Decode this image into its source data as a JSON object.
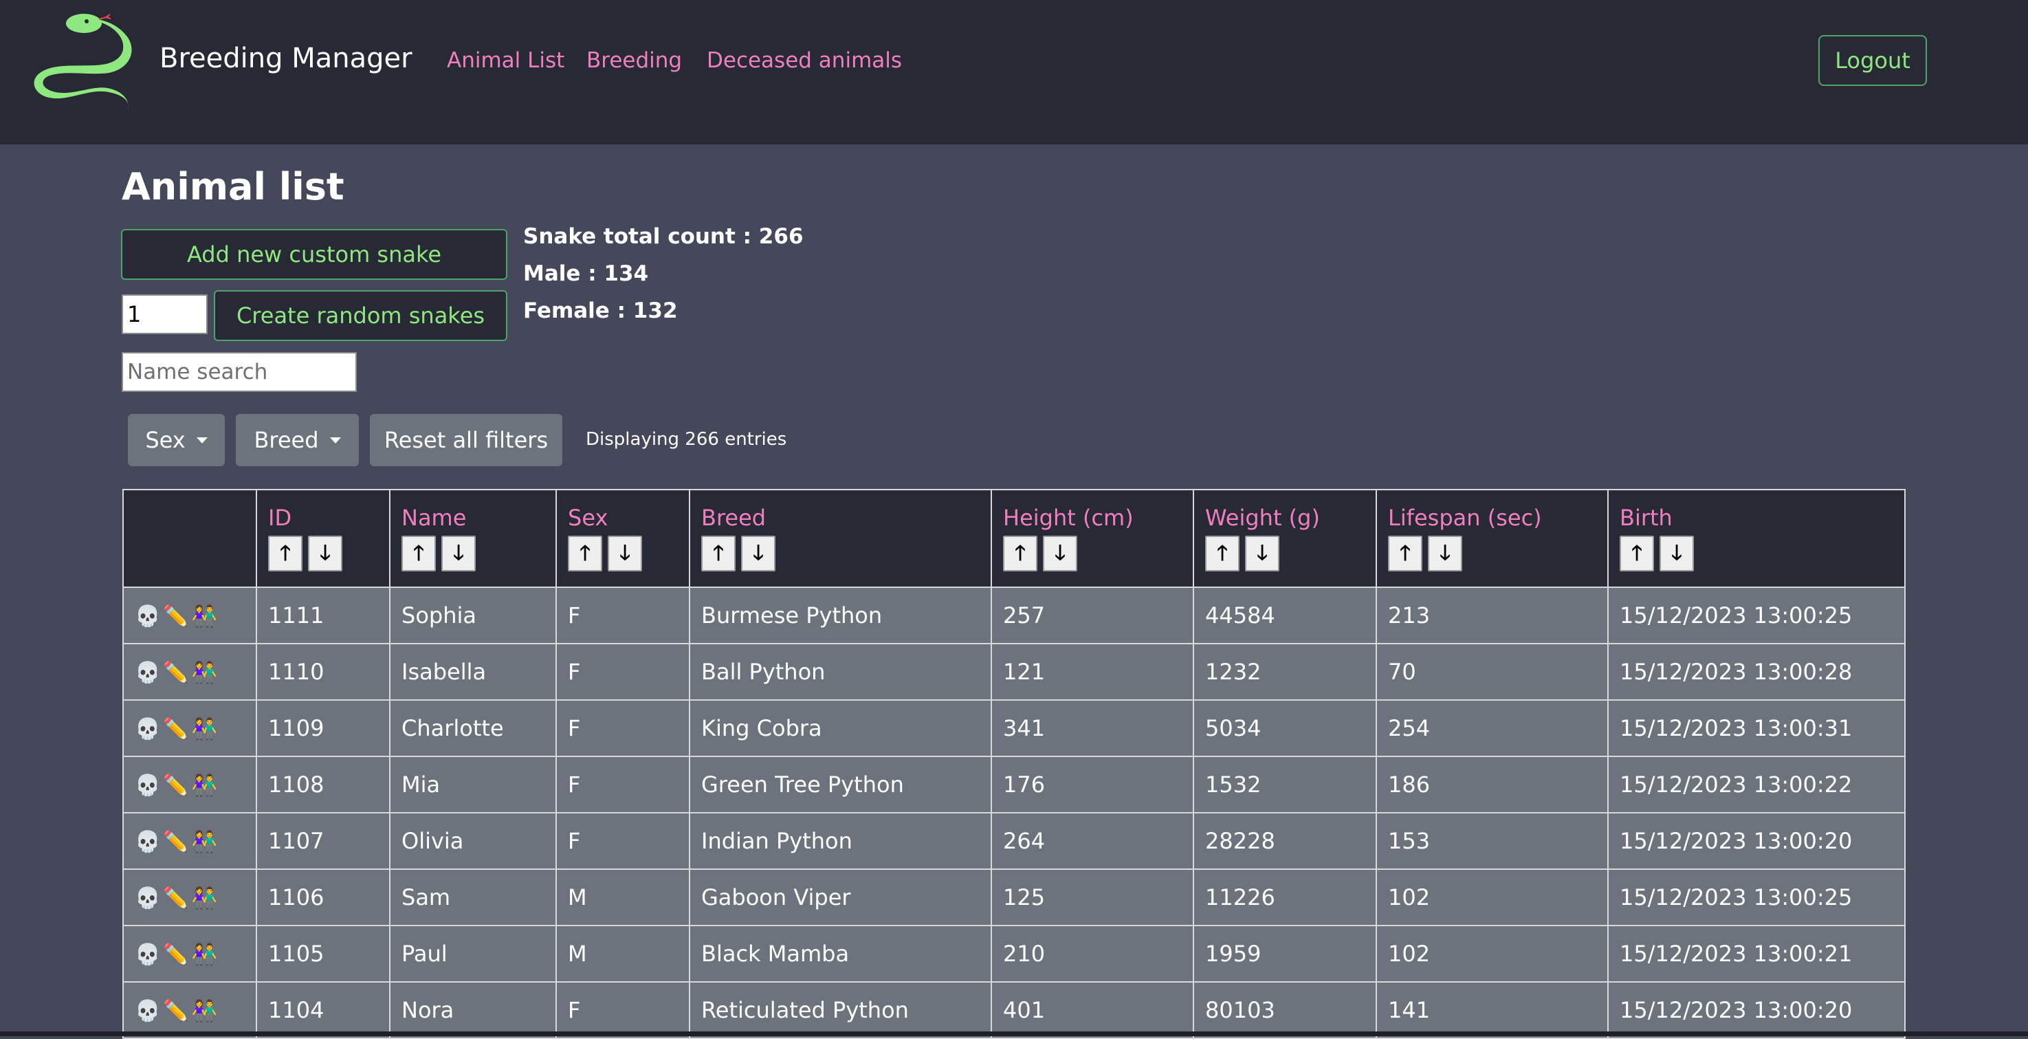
{
  "header": {
    "brand": "Breeding Manager",
    "nav": [
      "Animal List",
      "Breeding",
      "Deceased animals"
    ],
    "logout": "Logout",
    "logo_color": "#8ee87f",
    "accent_pink": "#f17fbf"
  },
  "main": {
    "title": "Animal list",
    "add_button": "Add new custom snake",
    "random_count": "1",
    "random_button": "Create random snakes",
    "search_placeholder": "Name search",
    "stats": {
      "total": "Snake total count : 266",
      "male": "Male : 134",
      "female": "Female : 132"
    },
    "filters": {
      "sex": "Sex",
      "breed": "Breed",
      "reset": "Reset all filters"
    },
    "displaying": "Displaying 266 entries"
  },
  "table": {
    "sort_up": "🡑",
    "sort_down": "🡓",
    "columns": [
      "ID",
      "Name",
      "Sex",
      "Breed",
      "Height (cm)",
      "Weight (g)",
      "Lifespan (sec)",
      "Birth"
    ],
    "action_icons": [
      "skull-icon",
      "pencil-icon",
      "couple-icon"
    ],
    "rows": [
      [
        "1111",
        "Sophia",
        "F",
        "Burmese Python",
        "257",
        "44584",
        "213",
        "15/12/2023 13:00:25"
      ],
      [
        "1110",
        "Isabella",
        "F",
        "Ball Python",
        "121",
        "1232",
        "70",
        "15/12/2023 13:00:28"
      ],
      [
        "1109",
        "Charlotte",
        "F",
        "King Cobra",
        "341",
        "5034",
        "254",
        "15/12/2023 13:00:31"
      ],
      [
        "1108",
        "Mia",
        "F",
        "Green Tree Python",
        "176",
        "1532",
        "186",
        "15/12/2023 13:00:22"
      ],
      [
        "1107",
        "Olivia",
        "F",
        "Indian Python",
        "264",
        "28228",
        "153",
        "15/12/2023 13:00:20"
      ],
      [
        "1106",
        "Sam",
        "M",
        "Gaboon Viper",
        "125",
        "11226",
        "102",
        "15/12/2023 13:00:25"
      ],
      [
        "1105",
        "Paul",
        "M",
        "Black Mamba",
        "210",
        "1959",
        "102",
        "15/12/2023 13:00:21"
      ],
      [
        "1104",
        "Nora",
        "F",
        "Reticulated Python",
        "401",
        "80103",
        "141",
        "15/12/2023 13:00:20"
      ]
    ]
  }
}
